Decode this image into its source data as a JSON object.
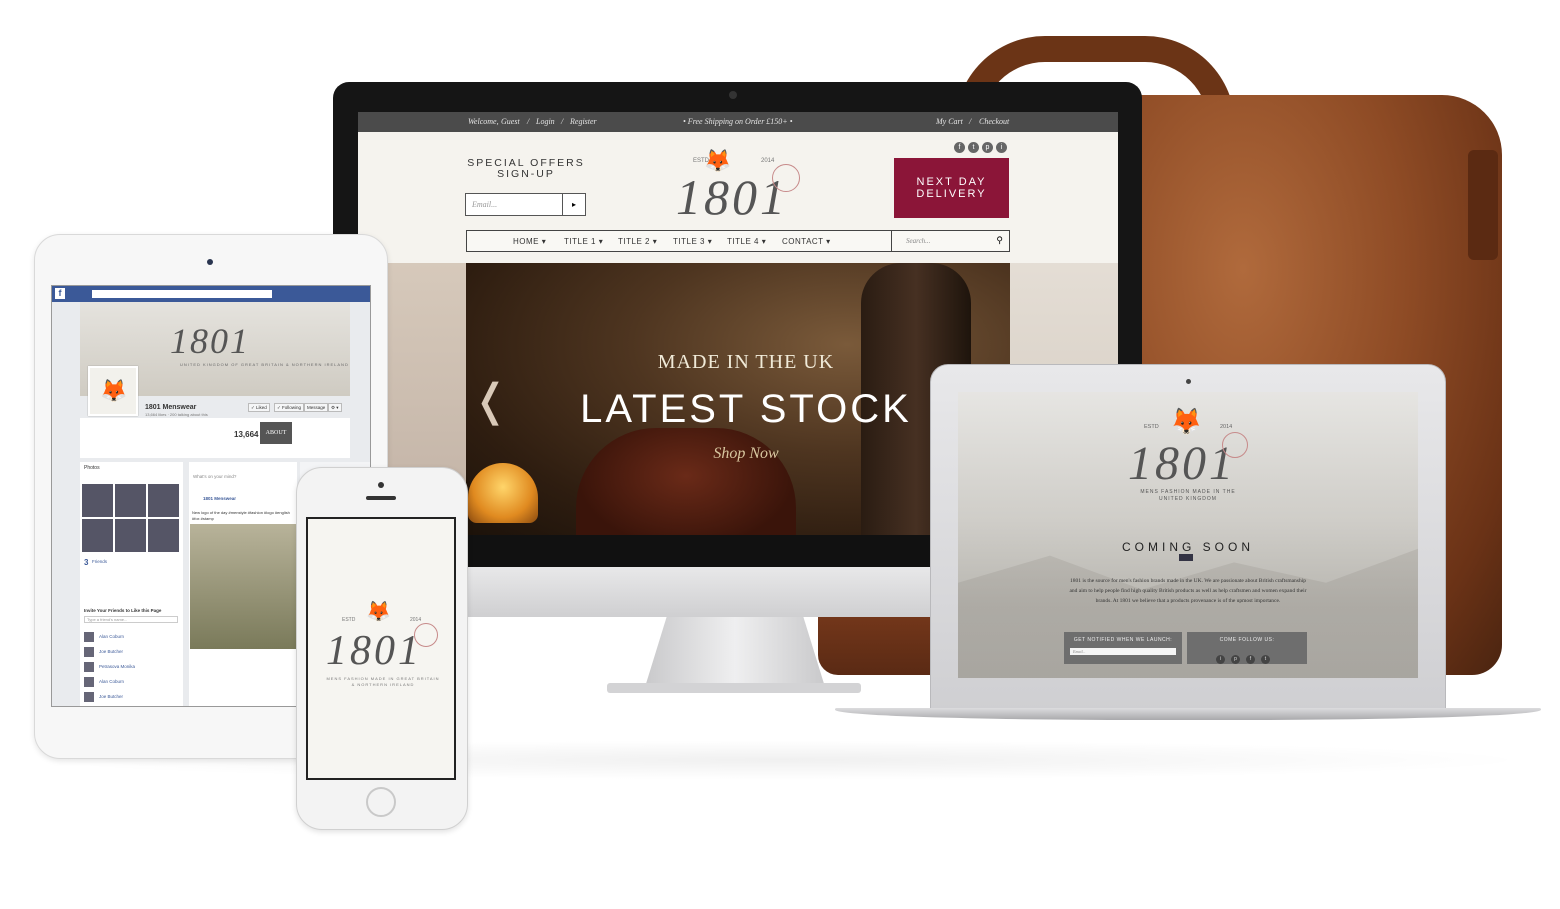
{
  "desktop": {
    "topbar": {
      "welcome": "Welcome,",
      "guest": "Guest",
      "login": "Login",
      "register": "Register",
      "sep": "/",
      "shipping": "•  Free Shipping on Order £150+  •",
      "cart": "My Cart",
      "checkout": "Checkout"
    },
    "social": [
      "f",
      "t",
      "p",
      "i"
    ],
    "offers_line1": "SPECIAL OFFERS",
    "offers_line2": "SIGN-UP",
    "email_placeholder": "Email...",
    "email_arrow": "▸",
    "logo": {
      "est": "ESTD",
      "year": "2014",
      "name": "1801"
    },
    "next_day_line1": "NEXT DAY",
    "next_day_line2": "DELIVERY",
    "nav": [
      "HOME",
      "TITLE 1",
      "TITLE 2",
      "TITLE 3",
      "TITLE 4",
      "CONTACT"
    ],
    "nav_caret": "▾",
    "search_placeholder": "Search...",
    "search_icon": "⚲",
    "hero": {
      "subtitle": "MADE IN THE UK",
      "title": "LATEST STOCK",
      "cta": "Shop Now",
      "prev_arrow": "❬"
    }
  },
  "facebook": {
    "logo": "f",
    "cover_logo": "1801",
    "cover_sub": "UNITED KINGDOM OF GREAT BRITAIN & NORTHERN IRELAND",
    "page_name": "1801 Menswear",
    "page_meta": "13,664 likes · 200 talking about this",
    "buttons": [
      "✓ Liked",
      "✓ Following",
      "Message",
      "⚙ ▾"
    ],
    "likes_count": "13,664",
    "about_tab": "ABOUT",
    "photos_label": "Photos",
    "friends_count": "3",
    "friends_label": "Friends",
    "invite_label": "Invite Your Friends to Like this Page",
    "invite_placeholder": "Type a friend's name...",
    "status_prompt": "What's on your mind?",
    "post_author": "1801 Menswear",
    "post_text": "New logo of the day #menstyle #fashion #logo #english #fox #stamp",
    "friends": [
      "Alan Coburn",
      "Joe Butcher",
      "Petrasova Monika",
      "Alan Coburn",
      "Joe Butcher"
    ]
  },
  "phone": {
    "est": "ESTD",
    "year": "2014",
    "logo": "1801",
    "sub_line1": "MENS FASHION MADE IN GREAT BRITAIN",
    "sub_line2": "& NORTHERN IRELAND"
  },
  "laptop": {
    "est": "ESTD",
    "year": "2014",
    "logo": "1801",
    "sub_line1": "MENS FASHION MADE IN THE",
    "sub_line2": "UNITED KINGDOM",
    "coming_soon": "COMING SOON",
    "body": "1801 is the source for men's fashion brands made in the UK. We are passionate about British craftsmanship and aim to help people find high quality British products as well as help craftsmen and women expand their brands. At 1801 we believe that a products provenance is of the upmost importance.",
    "notify_title": "GET NOTIFIED WHEN WE LAUNCH:",
    "notify_placeholder": "Email...",
    "follow_title": "COME FOLLOW US:",
    "follow_icons": [
      "i",
      "p",
      "f",
      "t"
    ]
  },
  "colors": {
    "brand_red": "#8b1538",
    "topbar": "#4b4b4b",
    "facebook_blue": "#3b5998",
    "leather": "#8e4b25"
  }
}
